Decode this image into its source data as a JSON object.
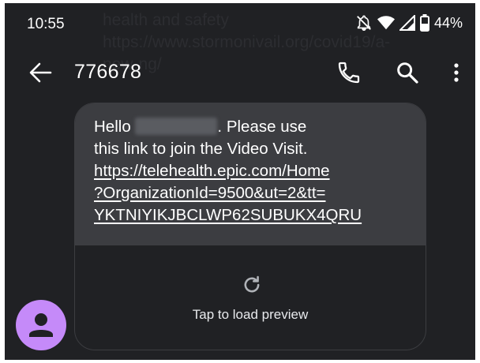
{
  "status_bar": {
    "time": "10:55",
    "battery_percent": "44%",
    "icons": [
      "mute-icon",
      "wifi-icon",
      "signal-icon",
      "battery-icon"
    ]
  },
  "background_ghost_text": "health and safety https://www.stormonivail.org/covid19/a-new-ng/",
  "app_bar": {
    "title": "776678",
    "icons": [
      "back-arrow-icon",
      "phone-icon",
      "search-icon",
      "more-vert-icon"
    ]
  },
  "message": {
    "greeting": "Hello",
    "line1_rest": ". Please use",
    "line2": "this link to join the Video Visit.",
    "link_lines": [
      "https://telehealth.epic.com/Home",
      "?OrganizationId=9500&ut=2&tt=",
      "YKTNIYIKJBCLWP62SUBUKX4QRU"
    ],
    "preview_label": "Tap to load preview"
  },
  "colors": {
    "background": "#202124",
    "bubble": "#3c3d41",
    "avatar": "#c58af9",
    "text": "#ffffff"
  }
}
